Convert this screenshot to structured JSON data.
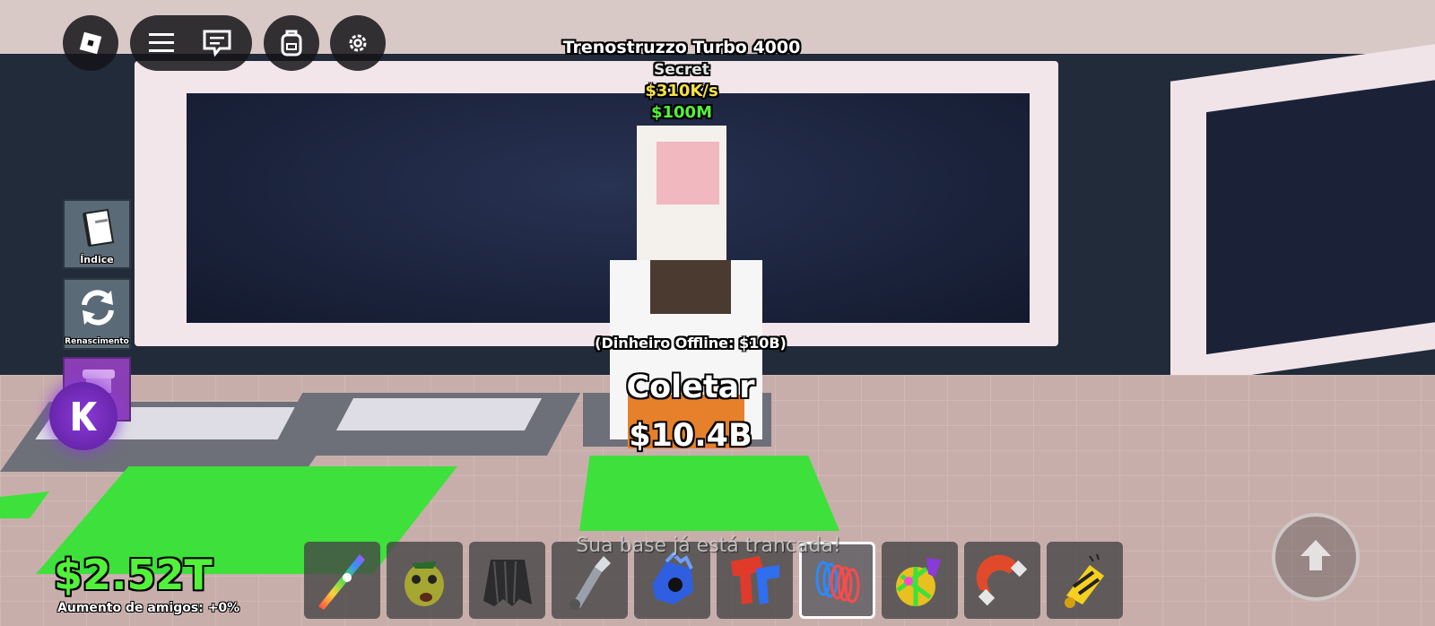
{
  "pet": {
    "name": "Trenostruzzo Turbo 4000",
    "rarity": "Secret",
    "income": "$310K/s",
    "price": "$100M"
  },
  "collector": {
    "offline": "(Dinheiro Offline: $10B)",
    "action": "Coletar",
    "amount": "$10.4B"
  },
  "sidebar": {
    "index_label": "Índice",
    "rebirth_label": "Renascimento"
  },
  "currency": {
    "amount": "$2.52T",
    "friends_boost": "Aumento de amigos: +0%"
  },
  "notice": "Sua base já está trancada!",
  "hotbar": {
    "selected_index": 6,
    "items": [
      {
        "icon": "rainbow-sword-icon"
      },
      {
        "icon": "zombie-head-icon"
      },
      {
        "icon": "dark-cape-icon"
      },
      {
        "icon": "flashlight-icon"
      },
      {
        "icon": "blue-glove-icon"
      },
      {
        "icon": "red-blue-blaster-icon"
      },
      {
        "icon": "spring-coil-icon"
      },
      {
        "icon": "disco-ball-icon"
      },
      {
        "icon": "magnet-icon"
      },
      {
        "icon": "bee-launcher-icon"
      }
    ]
  },
  "colors": {
    "money_green": "#53f23a",
    "income_yellow": "#f5e04a",
    "floor_green": "#3ee03b"
  }
}
